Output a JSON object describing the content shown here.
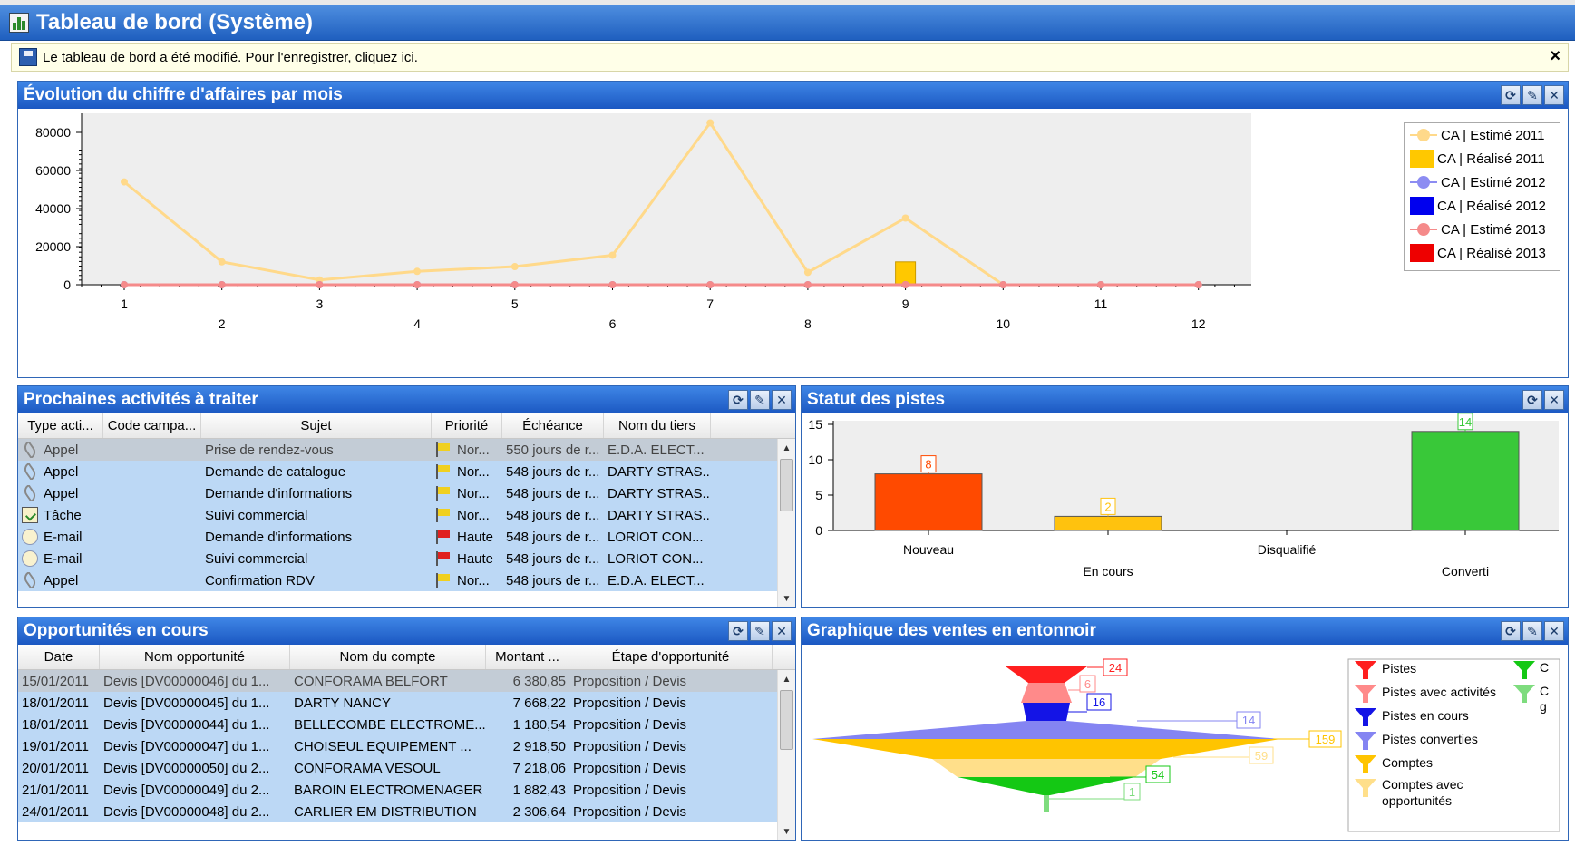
{
  "window": {
    "title": "Tableau de bord (Système)"
  },
  "notice": {
    "text": "Le tableau de bord a été modifié. Pour l'enregistrer, cliquez ici.",
    "close": "×"
  },
  "panels": {
    "revenue": {
      "title": "Évolution du chiffre d'affaires par mois"
    },
    "activities": {
      "title": "Prochaines activités à traiter"
    },
    "leads": {
      "title": "Statut des pistes"
    },
    "opportunities": {
      "title": "Opportunités en cours"
    },
    "funnel": {
      "title": "Graphique des ventes en entonnoir"
    }
  },
  "tool_icons": {
    "refresh": "⟳",
    "edit": "✎",
    "close": "✕"
  },
  "colors": {
    "title_bar": "#1f5fbf",
    "row_bg": "#bcd8f5",
    "row_selected": "#c3ccd6"
  },
  "activities": {
    "columns": [
      "Type acti...",
      "Code campa...",
      "Sujet",
      "Priorité",
      "Échéance",
      "Nom du tiers"
    ],
    "rows": [
      {
        "type": "Appel",
        "icon": "phone-icon",
        "code": "",
        "subject": "Prise de rendez-vous",
        "priority": "Nor...",
        "flag": "yellow",
        "due": "550 jours de r...",
        "party": "E.D.A. ELECT...",
        "selected": true
      },
      {
        "type": "Appel",
        "icon": "phone-icon",
        "code": "",
        "subject": "Demande de catalogue",
        "priority": "Nor...",
        "flag": "yellow",
        "due": "548 jours de r...",
        "party": "DARTY STRAS..."
      },
      {
        "type": "Appel",
        "icon": "phone-icon",
        "code": "",
        "subject": "Demande d'informations",
        "priority": "Nor...",
        "flag": "yellow",
        "due": "548 jours de r...",
        "party": "DARTY STRAS..."
      },
      {
        "type": "Tâche",
        "icon": "task-icon",
        "code": "",
        "subject": "Suivi commercial",
        "priority": "Nor...",
        "flag": "yellow",
        "due": "548 jours de r...",
        "party": "DARTY STRAS..."
      },
      {
        "type": "E-mail",
        "icon": "mail-icon",
        "code": "",
        "subject": "Demande d'informations",
        "priority": "Haute",
        "flag": "red",
        "due": "548 jours de r...",
        "party": "LORIOT CON..."
      },
      {
        "type": "E-mail",
        "icon": "mail-icon",
        "code": "",
        "subject": "Suivi commercial",
        "priority": "Haute",
        "flag": "red",
        "due": "548 jours de r...",
        "party": "LORIOT CON..."
      },
      {
        "type": "Appel",
        "icon": "phone-icon",
        "code": "",
        "subject": "Confirmation RDV",
        "priority": "Nor...",
        "flag": "yellow",
        "due": "548 jours de r...",
        "party": "E.D.A. ELECT..."
      }
    ]
  },
  "opportunities": {
    "columns": [
      "Date",
      "Nom opportunité",
      "Nom du compte",
      "Montant ...",
      "Étape d'opportunité"
    ],
    "rows": [
      {
        "date": "15/01/2011",
        "name": "Devis [DV00000046] du 1...",
        "account": "CONFORAMA BELFORT",
        "amount": "6 380,85",
        "stage": "Proposition / Devis",
        "selected": true
      },
      {
        "date": "18/01/2011",
        "name": "Devis [DV00000045] du 1...",
        "account": "DARTY NANCY",
        "amount": "7 668,22",
        "stage": "Proposition / Devis"
      },
      {
        "date": "18/01/2011",
        "name": "Devis [DV00000044] du 1...",
        "account": "BELLECOMBE ELECTROME...",
        "amount": "1 180,54",
        "stage": "Proposition / Devis"
      },
      {
        "date": "19/01/2011",
        "name": "Devis [DV00000047] du 1...",
        "account": "CHOISEUL EQUIPEMENT ...",
        "amount": "2 918,50",
        "stage": "Proposition / Devis"
      },
      {
        "date": "20/01/2011",
        "name": "Devis [DV00000050] du 2...",
        "account": "CONFORAMA VESOUL",
        "amount": "7 218,06",
        "stage": "Proposition / Devis"
      },
      {
        "date": "21/01/2011",
        "name": "Devis [DV00000049] du 2...",
        "account": "BAROIN ELECTROMENAGER",
        "amount": "1 882,43",
        "stage": "Proposition / Devis"
      },
      {
        "date": "24/01/2011",
        "name": "Devis [DV00000048] du 2...",
        "account": "CARLIER EM DISTRIBUTION",
        "amount": "2 306,64",
        "stage": "Proposition / Devis"
      }
    ]
  },
  "chart_data": [
    {
      "type": "line",
      "x": [
        1,
        2,
        3,
        4,
        5,
        6,
        7,
        8,
        9,
        10,
        11,
        12
      ],
      "ylim": [
        0,
        90000
      ],
      "yticks": [
        0,
        20000,
        40000,
        60000,
        80000
      ],
      "grid": false,
      "legend": "right",
      "series": [
        {
          "name": "CA | Estimé 2011",
          "kind": "line",
          "color": "#ffd98a",
          "values": [
            54000,
            12000,
            2500,
            7000,
            9500,
            15500,
            85000,
            6500,
            35000,
            0,
            0,
            0
          ]
        },
        {
          "name": "CA | Réalisé 2011",
          "kind": "bar",
          "color": "#ffc800",
          "values": [
            0,
            0,
            0,
            0,
            0,
            0,
            0,
            0,
            12000,
            0,
            0,
            0
          ]
        },
        {
          "name": "CA | Estimé 2012",
          "kind": "line",
          "color": "#8c8cf2",
          "values": [
            0,
            0,
            0,
            0,
            0,
            0,
            0,
            0,
            0,
            0,
            0,
            0
          ]
        },
        {
          "name": "CA | Réalisé 2012",
          "kind": "bar",
          "color": "#0000ee",
          "values": [
            0,
            0,
            0,
            0,
            0,
            0,
            0,
            0,
            0,
            0,
            0,
            0
          ]
        },
        {
          "name": "CA | Estimé 2013",
          "kind": "line",
          "color": "#f58a8a",
          "values": [
            0,
            0,
            0,
            0,
            0,
            0,
            0,
            0,
            0,
            0,
            0,
            0
          ]
        },
        {
          "name": "CA | Réalisé 2013",
          "kind": "bar",
          "color": "#ee0000",
          "values": [
            0,
            0,
            0,
            0,
            0,
            0,
            0,
            0,
            0,
            0,
            0,
            0
          ]
        }
      ]
    },
    {
      "type": "bar",
      "categories": [
        "Nouveau",
        "En cours",
        "Disqualifié",
        "Converti"
      ],
      "values": [
        8,
        2,
        0,
        14
      ],
      "colors": [
        "#ff4a00",
        "#ffc20e",
        "#cccccc",
        "#39c839"
      ],
      "ylim": [
        0,
        15
      ],
      "yticks": [
        0,
        5,
        10,
        15
      ],
      "grid": false
    },
    {
      "type": "funnel",
      "categories": [
        "Pistes",
        "Pistes avec activités",
        "Pistes en cours",
        "Pistes converties",
        "Comptes",
        "Comptes avec opportunités",
        "C g",
        "C"
      ],
      "values": [
        24,
        6,
        16,
        14,
        159,
        59,
        54,
        1
      ],
      "colors": [
        "#ff1f1f",
        "#ff8a8a",
        "#1414e6",
        "#8484f2",
        "#ffc400",
        "#ffdf8a",
        "#14c814",
        "#7edc7e"
      ],
      "legend": "right"
    }
  ]
}
